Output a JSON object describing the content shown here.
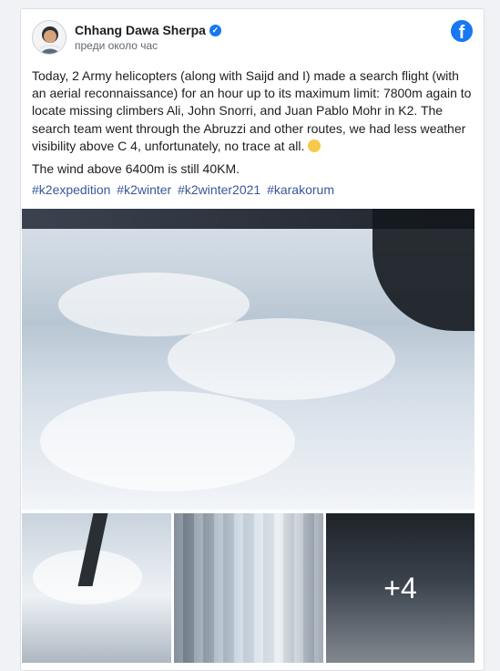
{
  "post": {
    "author": "Chhang Dawa Sherpa",
    "timestamp": "преди около час",
    "paragraphs": [
      "Today, 2 Army helicopters (along with Saijd and I) made a search flight (with an aerial reconnaissance) for an hour up to its maximum limit: 7800m again to locate missing climbers Ali, John Snorri, and Juan Pablo Mohr in K2. The search team went through the Abruzzi and other routes, we had less weather visibility above C 4, unfortunately, no trace at all.",
      "The wind above 6400m is still 40KM."
    ],
    "hashtags": [
      "#k2expedition",
      "#k2winter",
      "#k2winter2021",
      "#karakorum"
    ],
    "more_photos_count": "+4"
  },
  "colors": {
    "brand": "#1877f2",
    "hashtag": "#385898",
    "text": "#1c1e21",
    "subtext": "#606770"
  },
  "icons": {
    "verified": "verified-badge-icon",
    "platform": "facebook-logo-icon",
    "emoji": "pensive-face-icon"
  }
}
